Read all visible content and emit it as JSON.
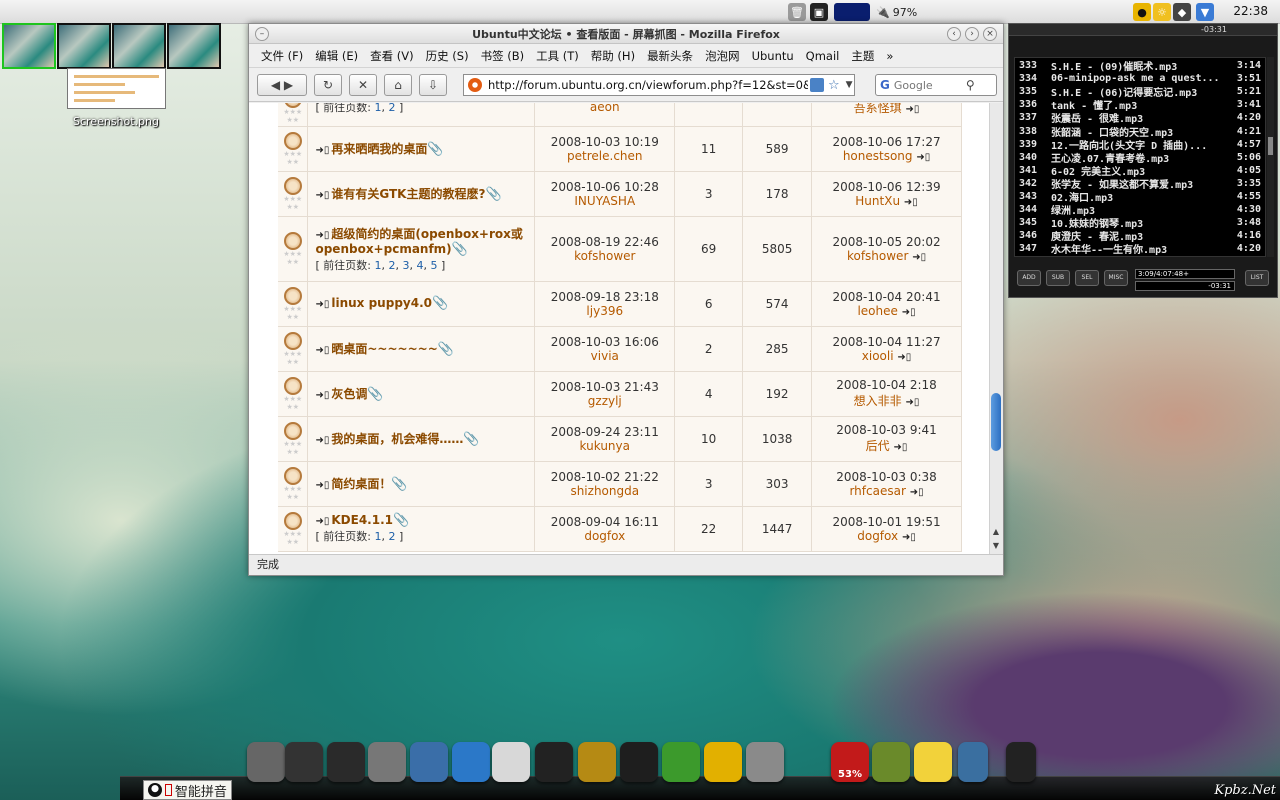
{
  "top_panel": {
    "battery": "97%",
    "clock": "22:38"
  },
  "desktop": {
    "icon_label": "Screenshot.png",
    "watermark": "Kpbz.Net"
  },
  "firefox": {
    "title": "Ubuntu中文论坛 • 查看版面 - 屏幕抓图 - Mozilla Firefox",
    "menu": [
      "文件 (F)",
      "编辑 (E)",
      "查看 (V)",
      "历史 (S)",
      "书签 (B)",
      "工具 (T)",
      "帮助 (H)",
      "最新头条",
      "泡泡网",
      "Ubuntu",
      "Qmail",
      "主题",
      "»"
    ],
    "url": "http://forum.ubuntu.org.cn/viewforum.php?f=12&st=0&",
    "search_placeholder": "Google",
    "status": "完成",
    "page_prefix": "[ 前往页数:",
    "page_suffix": "]"
  },
  "topics": [
    {
      "title": "",
      "pages": [
        "1",
        "2"
      ],
      "author_date": "",
      "author": "aeon",
      "replies": "",
      "views": "",
      "last_date": "",
      "last_user": "吾系怪琪"
    },
    {
      "title": "再来晒晒我的桌面",
      "pages": [],
      "author_date": "2008-10-03 10:19",
      "author": "petrele.chen",
      "replies": "11",
      "views": "589",
      "last_date": "2008-10-06 17:27",
      "last_user": "honestsong"
    },
    {
      "title": "谁有有关GTK主题的教程麽?",
      "pages": [],
      "author_date": "2008-10-06 10:28",
      "author": "INUYASHA",
      "replies": "3",
      "views": "178",
      "last_date": "2008-10-06 12:39",
      "last_user": "HuntXu"
    },
    {
      "title": "超级简约的桌面(openbox+rox或openbox+pcmanfm)",
      "pages": [
        "1",
        "2",
        "3",
        "4",
        "5"
      ],
      "author_date": "2008-08-19 22:46",
      "author": "kofshower",
      "replies": "69",
      "views": "5805",
      "last_date": "2008-10-05 20:02",
      "last_user": "kofshower"
    },
    {
      "title": "linux puppy4.0",
      "pages": [],
      "author_date": "2008-09-18 23:18",
      "author": "ljy396",
      "replies": "6",
      "views": "574",
      "last_date": "2008-10-04 20:41",
      "last_user": "leohee"
    },
    {
      "title": "晒桌面~~~~~~~",
      "pages": [],
      "author_date": "2008-10-03 16:06",
      "author": "vivia",
      "replies": "2",
      "views": "285",
      "last_date": "2008-10-04 11:27",
      "last_user": "xiooli"
    },
    {
      "title": "灰色调",
      "pages": [],
      "author_date": "2008-10-03 21:43",
      "author": "gzzylj",
      "replies": "4",
      "views": "192",
      "last_date": "2008-10-04 2:18",
      "last_user": "想入非非"
    },
    {
      "title": "我的桌面，机会难得……",
      "pages": [],
      "author_date": "2008-09-24 23:11",
      "author": "kukunya",
      "replies": "10",
      "views": "1038",
      "last_date": "2008-10-03 9:41",
      "last_user": "后代"
    },
    {
      "title": "简约桌面！",
      "pages": [],
      "author_date": "2008-10-02 21:22",
      "author": "shizhongda",
      "replies": "3",
      "views": "303",
      "last_date": "2008-10-03 0:38",
      "last_user": "rhfcaesar"
    },
    {
      "title": "KDE4.1.1",
      "pages": [
        "1",
        "2"
      ],
      "author_date": "2008-09-04 16:11",
      "author": "dogfox",
      "replies": "22",
      "views": "1447",
      "last_date": "2008-10-01 19:51",
      "last_user": "dogfox"
    }
  ],
  "player": {
    "remaining": "-03:31",
    "time": "3:09/4:07:48+",
    "time2": "-03:31",
    "buttons": [
      "ADD",
      "SUB",
      "SEL",
      "MISC"
    ],
    "list_button": "LIST",
    "tracks": [
      {
        "num": "333",
        "name": "S.H.E - (09)催眠术.mp3",
        "dur": "3:14"
      },
      {
        "num": "334",
        "name": "06-minipop-ask me a quest...",
        "dur": "3:51"
      },
      {
        "num": "335",
        "name": "S.H.E - (06)记得要忘记.mp3",
        "dur": "5:21"
      },
      {
        "num": "336",
        "name": "tank - 懂了.mp3",
        "dur": "3:41"
      },
      {
        "num": "337",
        "name": "张震岳 - 很难.mp3",
        "dur": "4:20"
      },
      {
        "num": "338",
        "name": "张韶涵 - 口袋的天空.mp3",
        "dur": "4:21"
      },
      {
        "num": "339",
        "name": "12.一路向北(头文字 D 插曲)...",
        "dur": "4:57"
      },
      {
        "num": "340",
        "name": "王心凌.07.青春考卷.mp3",
        "dur": "5:06"
      },
      {
        "num": "341",
        "name": "6-02 完美主义.mp3",
        "dur": "4:05"
      },
      {
        "num": "342",
        "name": "张学友 - 如果这都不算爱.mp3",
        "dur": "3:35"
      },
      {
        "num": "343",
        "name": "02.海口.mp3",
        "dur": "4:55"
      },
      {
        "num": "344",
        "name": "绿洲.mp3",
        "dur": "4:30"
      },
      {
        "num": "345",
        "name": "10.妹妹的钢琴.mp3",
        "dur": "3:48"
      },
      {
        "num": "346",
        "name": "庾澄庆 - 春泥.mp3",
        "dur": "4:16"
      },
      {
        "num": "347",
        "name": "水木年华--一生有你.mp3",
        "dur": "4:20"
      }
    ]
  },
  "dock": {
    "ime_label": "智能拼音",
    "cpu_label": "53%"
  }
}
